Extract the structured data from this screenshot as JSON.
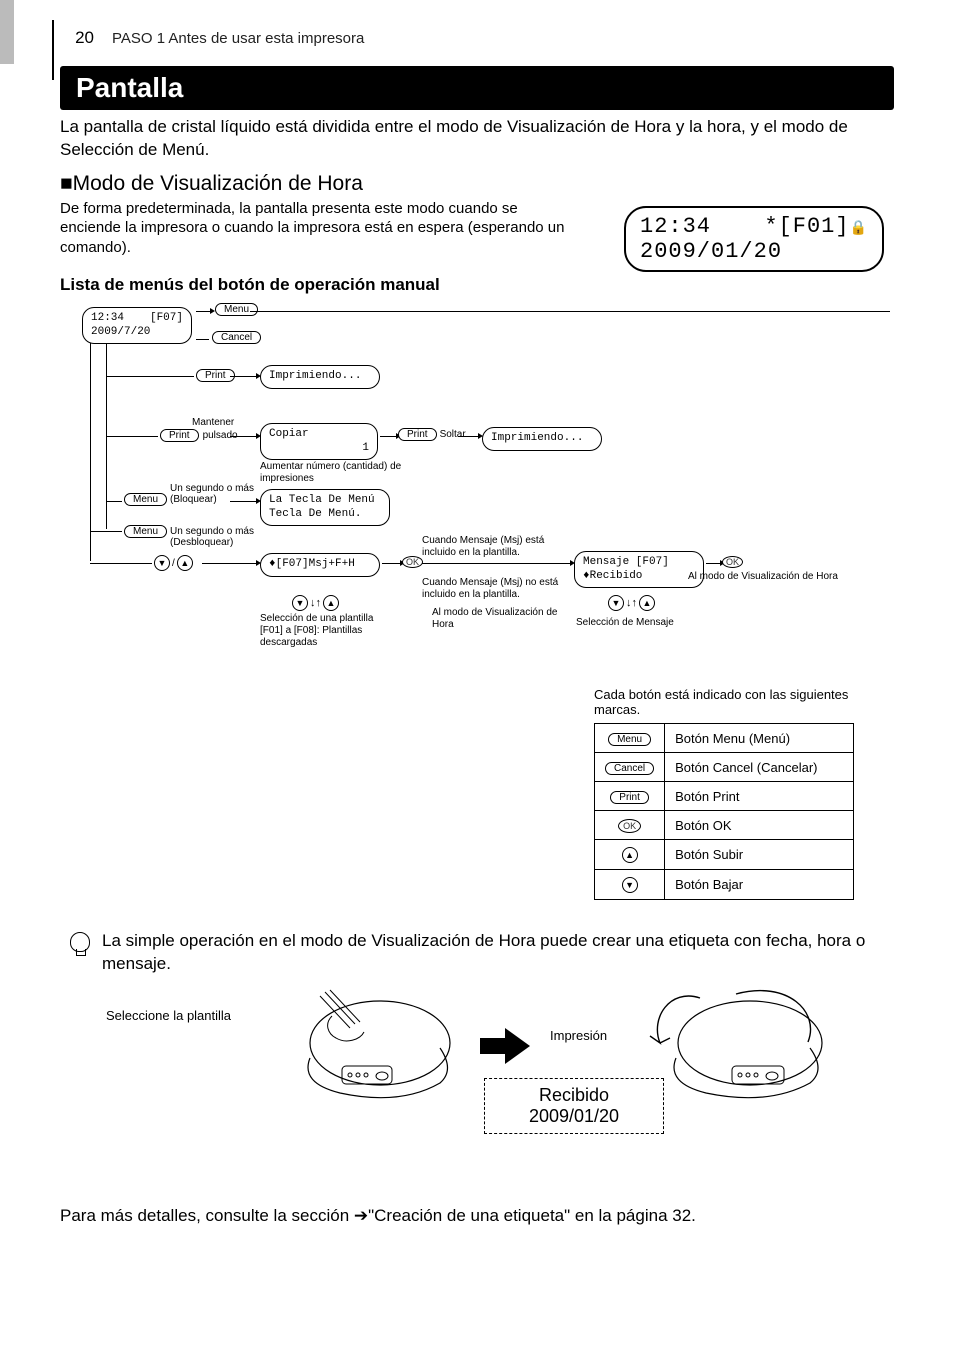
{
  "page_number": "20",
  "header_breadcrumb": "PASO 1 Antes de usar esta impresora",
  "section_title": "Pantalla",
  "intro_paragraph": "La pantalla de cristal líquido está dividida entre el modo de Visualización de Hora y la hora, y el modo de Selección de Menú.",
  "subheading": "Modo de Visualización de Hora",
  "subheading_paragraph": "De forma predeterminada, la pantalla presenta este modo cuando se enciende la impresora o cuando la impresora está en espera (esperando un comando).",
  "lcd": {
    "time": "12:34",
    "template_indicator": "*[F01]",
    "date": "2009/01/20"
  },
  "menu_list_title": "Lista de menús del botón de operación manual",
  "flowchart": {
    "start_box": {
      "time": "12:34",
      "tpl": "[F07]",
      "date": "2009/7/20"
    },
    "btn_menu": "Menu",
    "btn_cancel": "Cancel",
    "btn_print": "Print",
    "btn_ok": "OK",
    "printing_box": "Imprimiendo...",
    "hold_label": "Mantener",
    "hold_label2": "pulsado",
    "copy_box_l1": "Copiar",
    "copy_box_l2": "1",
    "soltar_label": "Soltar",
    "printing_box2": "Imprimiendo...",
    "increase_label": "Aumentar número (cantidad) de impresiones",
    "lock_label_top": "Un segundo o más",
    "lock_label_bottom": "(Bloquear)",
    "unlock_label_top": "Un segundo o más",
    "unlock_label_bottom": "(Desbloquear)",
    "menu_key_box_l1": "La Tecla De Menú",
    "menu_key_box_l2": "Tecla De Menú.",
    "template_box": "♦[F07]Msj+F+H",
    "msg_incl": "Cuando Mensaje (Msj) está incluido en la plantilla.",
    "msg_notincl": "Cuando Mensaje (Msj) no está incluido en la plantilla.",
    "to_time_mode": "Al modo de Visualización de Hora",
    "to_time_mode2": "Al modo de Visualización de Hora",
    "template_note_l1": "Selección de una plantilla",
    "template_note_l2": "[F01] a [F08]: Plantillas descargadas",
    "message_box_l1": "Mensaje  [F07]",
    "message_box_l2": "♦Recibido",
    "message_select": "Selección de Mensaje"
  },
  "legend_intro": "Cada botón está indicado con las siguientes marcas.",
  "legend_rows": [
    {
      "icon": "Menu",
      "desc": "Botón Menu (Menú)"
    },
    {
      "icon": "Cancel",
      "desc": "Botón Cancel (Cancelar)"
    },
    {
      "icon": "Print",
      "desc": "Botón Print"
    },
    {
      "icon": "OK",
      "desc": "Botón OK"
    },
    {
      "icon": "▲",
      "desc": "Botón Subir"
    },
    {
      "icon": "▼",
      "desc": "Botón Bajar"
    }
  ],
  "tip_text": "La simple operación en el modo de Visualización de Hora puede crear una etiqueta con fecha, hora o mensaje.",
  "illus": {
    "select_template": "Seleccione la plantilla",
    "impresion": "Impresión",
    "recibido_l1": "Recibido",
    "recibido_l2": "2009/01/20"
  },
  "footer_prefix": "Para más detalles, consulte la sección ",
  "footer_ref": "➔\"Creación de una etiqueta\" en la página 32."
}
